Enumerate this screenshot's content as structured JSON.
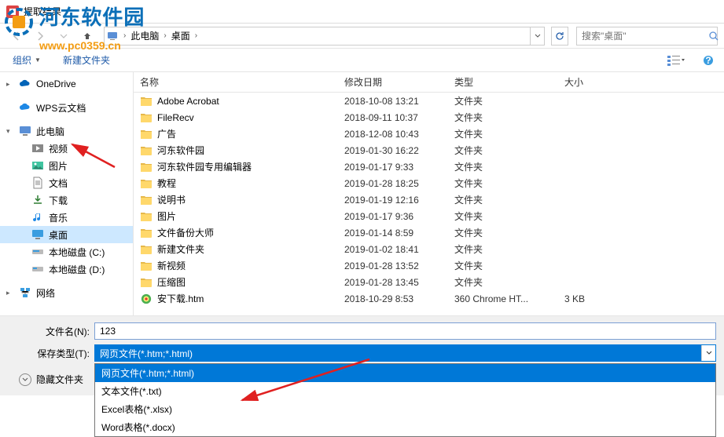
{
  "title": "提取结果",
  "watermark": {
    "line1": "河东软件园",
    "line2": "www.pc0359.cn"
  },
  "breadcrumb": {
    "items": [
      "此电脑",
      "桌面"
    ]
  },
  "search": {
    "placeholder": "搜索\"桌面\""
  },
  "toolbar": {
    "organize": "组织",
    "newfolder": "新建文件夹"
  },
  "columns": {
    "name": "名称",
    "date": "修改日期",
    "type": "类型",
    "size": "大小"
  },
  "sidebar": {
    "onedrive": "OneDrive",
    "wps": "WPS云文档",
    "thispc": "此电脑",
    "video": "视频",
    "pictures": "图片",
    "docs": "文档",
    "downloads": "下载",
    "music": "音乐",
    "desktop": "桌面",
    "diskc": "本地磁盘 (C:)",
    "diskd": "本地磁盘 (D:)",
    "network": "网络"
  },
  "files": [
    {
      "name": "Adobe Acrobat",
      "date": "2018-10-08 13:21",
      "type": "文件夹",
      "size": "",
      "icon": "folder"
    },
    {
      "name": "FileRecv",
      "date": "2018-09-11 10:37",
      "type": "文件夹",
      "size": "",
      "icon": "folder"
    },
    {
      "name": "广告",
      "date": "2018-12-08 10:43",
      "type": "文件夹",
      "size": "",
      "icon": "folder"
    },
    {
      "name": "河东软件园",
      "date": "2019-01-30 16:22",
      "type": "文件夹",
      "size": "",
      "icon": "folder"
    },
    {
      "name": "河东软件园专用编辑器",
      "date": "2019-01-17 9:33",
      "type": "文件夹",
      "size": "",
      "icon": "folder"
    },
    {
      "name": "教程",
      "date": "2019-01-28 18:25",
      "type": "文件夹",
      "size": "",
      "icon": "folder"
    },
    {
      "name": "说明书",
      "date": "2019-01-19 12:16",
      "type": "文件夹",
      "size": "",
      "icon": "folder"
    },
    {
      "name": "图片",
      "date": "2019-01-17 9:36",
      "type": "文件夹",
      "size": "",
      "icon": "folder"
    },
    {
      "name": "文件备份大师",
      "date": "2019-01-14 8:59",
      "type": "文件夹",
      "size": "",
      "icon": "folder"
    },
    {
      "name": "新建文件夹",
      "date": "2019-01-02 18:41",
      "type": "文件夹",
      "size": "",
      "icon": "folder"
    },
    {
      "name": "新视频",
      "date": "2019-01-28 13:52",
      "type": "文件夹",
      "size": "",
      "icon": "folder"
    },
    {
      "name": "压缩图",
      "date": "2019-01-28 13:45",
      "type": "文件夹",
      "size": "",
      "icon": "folder"
    },
    {
      "name": "安下载.htm",
      "date": "2018-10-29 8:53",
      "type": "360 Chrome HT...",
      "size": "3 KB",
      "icon": "htm"
    }
  ],
  "form": {
    "filename_label": "文件名(N):",
    "filename_value": "123",
    "savetype_label": "保存类型(T):",
    "savetype_value": "网页文件(*.htm;*.html)",
    "hide_label": "隐藏文件夹"
  },
  "dropdown": [
    "网页文件(*.htm;*.html)",
    "文本文件(*.txt)",
    "Excel表格(*.xlsx)",
    "Word表格(*.docx)"
  ]
}
